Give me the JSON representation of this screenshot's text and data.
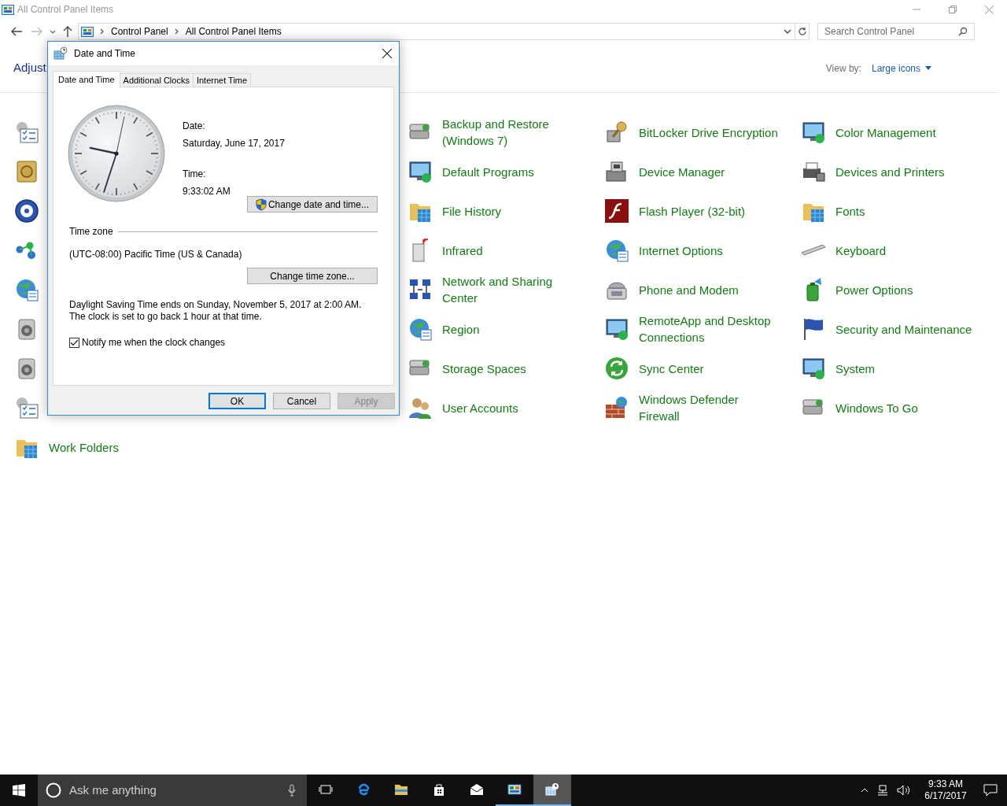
{
  "window": {
    "title": "All Control Panel Items",
    "breadcrumb": [
      "Control Panel",
      "All Control Panel Items"
    ],
    "search": {
      "placeholder": "Search Control Panel"
    }
  },
  "header": {
    "heading": "Adjust",
    "view_by_label": "View by:",
    "view_by_value": "Large icons"
  },
  "columns": [
    {
      "items": [
        {
          "kind": "icon-only"
        },
        {
          "kind": "icon-only"
        },
        {
          "kind": "icon-only"
        },
        {
          "kind": "icon-only"
        },
        {
          "kind": "icon-only"
        },
        {
          "kind": "icon-only"
        },
        {
          "kind": "icon-only"
        },
        {
          "kind": "icon-only"
        },
        {
          "kind": "labeled",
          "label": "Work Folders"
        }
      ]
    },
    {
      "items": [
        {
          "kind": "labeled",
          "label": "Backup and Restore (Windows 7)"
        },
        {
          "kind": "labeled",
          "label": "Default Programs"
        },
        {
          "kind": "labeled",
          "label": "File History"
        },
        {
          "kind": "labeled",
          "label": "Infrared"
        },
        {
          "kind": "labeled",
          "label": "Network and Sharing Center"
        },
        {
          "kind": "labeled",
          "label": "Region"
        },
        {
          "kind": "labeled",
          "label": "Storage Spaces"
        },
        {
          "kind": "labeled",
          "label": "User Accounts"
        }
      ]
    },
    {
      "items": [
        {
          "kind": "labeled",
          "label": "BitLocker Drive Encryption"
        },
        {
          "kind": "labeled",
          "label": "Device Manager"
        },
        {
          "kind": "labeled",
          "label": "Flash Player (32-bit)"
        },
        {
          "kind": "labeled",
          "label": "Internet Options"
        },
        {
          "kind": "labeled",
          "label": "Phone and Modem"
        },
        {
          "kind": "labeled",
          "label": "RemoteApp and Desktop Connections"
        },
        {
          "kind": "labeled",
          "label": "Sync Center"
        },
        {
          "kind": "labeled",
          "label": "Windows Defender Firewall"
        }
      ]
    },
    {
      "items": [
        {
          "kind": "labeled",
          "label": "Color Management"
        },
        {
          "kind": "labeled",
          "label": "Devices and Printers"
        },
        {
          "kind": "labeled",
          "label": "Fonts"
        },
        {
          "kind": "labeled",
          "label": "Keyboard"
        },
        {
          "kind": "labeled",
          "label": "Power Options"
        },
        {
          "kind": "labeled",
          "label": "Security and Maintenance"
        },
        {
          "kind": "labeled",
          "label": "System"
        },
        {
          "kind": "labeled",
          "label": "Windows To Go"
        }
      ]
    }
  ],
  "dialog": {
    "title": "Date and Time",
    "tabs": [
      {
        "label": "Date and Time",
        "selected": true
      },
      {
        "label": "Additional Clocks",
        "selected": false
      },
      {
        "label": "Internet Time",
        "selected": false
      }
    ],
    "date_label": "Date:",
    "date": "Saturday, June 17, 2017",
    "time_label": "Time:",
    "time": "9:33:02 AM",
    "change_datetime_button": "Change date and time...",
    "timezone_group": "Time zone",
    "timezone": "(UTC-08:00) Pacific Time (US & Canada)",
    "change_timezone_button": "Change time zone...",
    "dst_note": "Daylight Saving Time ends on Sunday, November 5, 2017 at 2:00 AM. The clock is set to go back 1 hour at that time.",
    "notify": {
      "label": "Notify me when the clock changes",
      "checked": true
    },
    "buttons": [
      {
        "label": "OK",
        "default": true,
        "disabled": false
      },
      {
        "label": "Cancel",
        "default": false,
        "disabled": false
      },
      {
        "label": "Apply",
        "default": false,
        "disabled": true
      }
    ]
  },
  "taskbar": {
    "search_placeholder": "Ask me anything",
    "apps": [
      {
        "running": false,
        "selected": false
      },
      {
        "running": false,
        "selected": false
      },
      {
        "running": false,
        "selected": false
      },
      {
        "running": false,
        "selected": false
      },
      {
        "running": false,
        "selected": false
      },
      {
        "running": true,
        "selected": false
      },
      {
        "running": true,
        "selected": true
      }
    ],
    "time": "9:33 AM",
    "date": "6/17/2017"
  }
}
